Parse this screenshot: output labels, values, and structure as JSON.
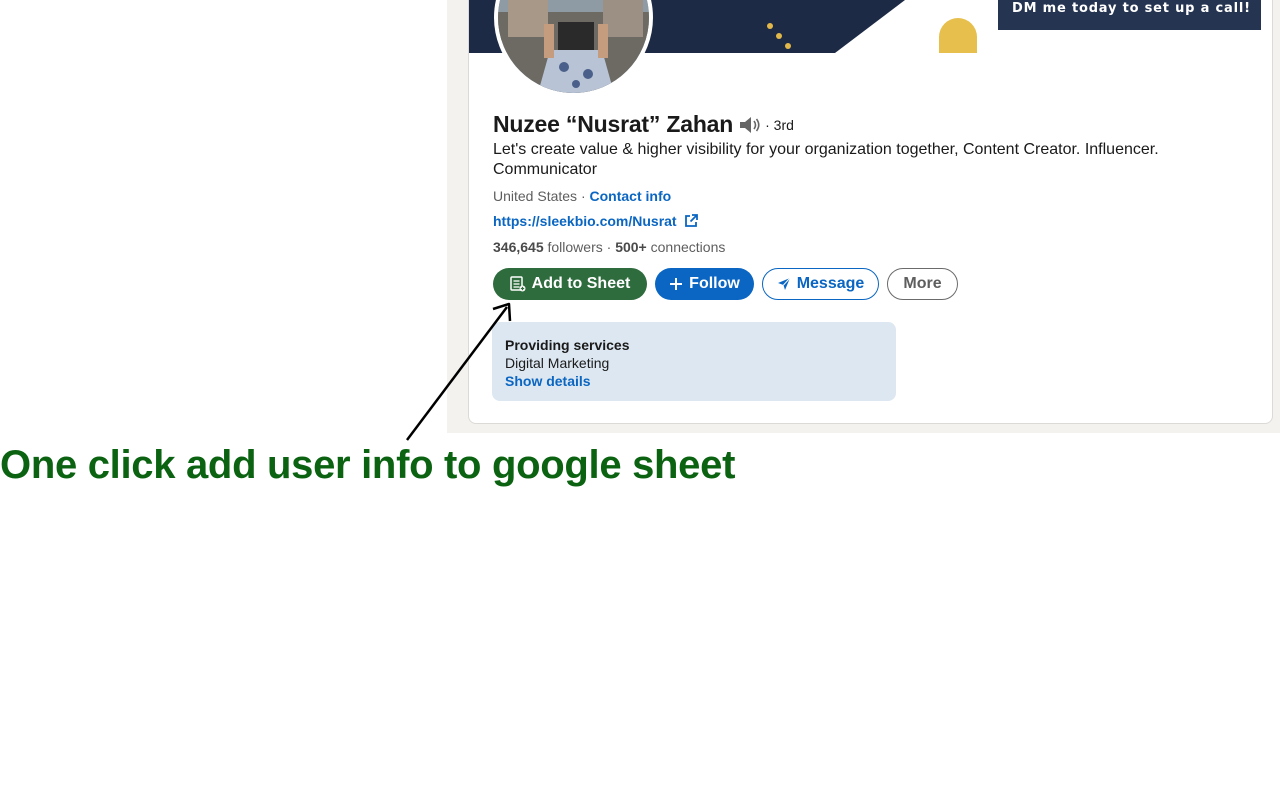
{
  "banner": {
    "cta_text": "DM me today to set up a call!"
  },
  "profile": {
    "name": "Nuzee “Nusrat” Zahan",
    "degree": "· 3rd",
    "headline": "Let's create value & higher visibility for your organization together, Content Creator. Influencer. Communicator",
    "location": "United States",
    "location_separator": " · ",
    "contact_info": "Contact info",
    "website": "https://sleekbio.com/Nusrat",
    "followers_count": "346,645",
    "followers_label": " followers",
    "connections_count": "500+",
    "connections_label": " connections",
    "stats_separator": " · "
  },
  "actions": {
    "add_to_sheet": "Add to Sheet",
    "follow": "Follow",
    "message": "Message",
    "more": "More"
  },
  "services": {
    "title": "Providing services",
    "value": "Digital Marketing",
    "show_details": "Show details"
  },
  "annotation": {
    "caption": "One click add user info to google sheet"
  },
  "icons": {
    "add_to_sheet": "sheet-icon",
    "follow": "plus-icon",
    "message": "paper-plane-icon",
    "website": "external-link-icon",
    "name_pronunciation": "speaker-icon"
  },
  "colors": {
    "linkedin_blue": "#0a66c2",
    "sheet_green": "#2e6b3d",
    "caption_green": "#0b6312",
    "banner_navy": "#1d2a45"
  }
}
